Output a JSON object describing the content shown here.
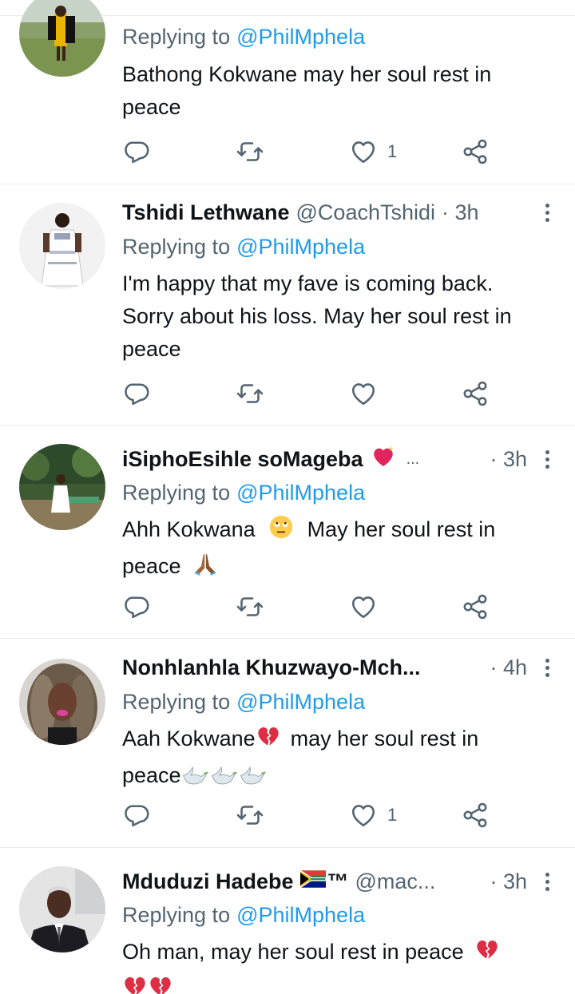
{
  "colors": {
    "text": "#0f1419",
    "muted": "#536471",
    "link": "#1d9bf0",
    "divider": "#e6ecf0"
  },
  "tweets": [
    {
      "replying_prefix": "Replying to",
      "replying_to": "@PhilMphela",
      "lines": [
        "Bathong Kokwane may her soul rest in",
        "peace"
      ],
      "likes": "1",
      "icons": [
        "reply-icon",
        "retweet-icon",
        "like-icon",
        "share-icon"
      ]
    },
    {
      "name": "Tshidi Lethwane",
      "handle": "@CoachTshidi",
      "time": "· 3h",
      "replying_prefix": "Replying to",
      "replying_to": "@PhilMphela",
      "lines": [
        "I'm happy that my fave is coming back.",
        "Sorry about his loss. May her soul rest in",
        "peace"
      ],
      "likes": ""
    },
    {
      "name": "iSiphoEsihle soMageba",
      "handle": "...",
      "time": "· 3h",
      "replying_prefix": "Replying to",
      "replying_to": "@PhilMphela",
      "line1_a": "Ahh Kokwana",
      "line1_b": "May her soul rest in",
      "line2": "peace",
      "emoji_names": [
        "sparkling-heart-emoji",
        "rolling-eyes-emoji",
        "folded-hands-emoji"
      ],
      "likes": ""
    },
    {
      "name": "Nonhlanhla Khuzwayo-Mch...",
      "handle": "",
      "time": "· 4h",
      "replying_prefix": "Replying to",
      "replying_to": "@PhilMphela",
      "line1_a": "Aah Kokwane",
      "line1_b": "may her soul rest in",
      "line2": "peace",
      "emoji_names": [
        "broken-heart-emoji",
        "dove-emoji"
      ],
      "likes": "1"
    },
    {
      "name": "Mduduzi Hadebe",
      "tm": "™",
      "handle": "@mac...",
      "time": "· 3h",
      "replying_prefix": "Replying to",
      "replying_to": "@PhilMphela",
      "line1": "Oh man, may her soul rest in peace",
      "emoji_names": [
        "south-africa-flag-emoji",
        "broken-heart-emoji"
      ]
    }
  ]
}
